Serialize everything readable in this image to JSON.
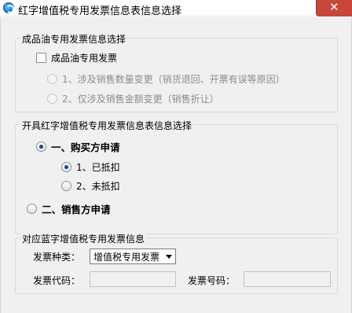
{
  "window": {
    "title": "红字增值税专用发票信息表信息选择",
    "close_label": "✕"
  },
  "oil_group": {
    "legend": "成品油专用发票信息选择",
    "checkbox_label": "成品油专用发票",
    "options": [
      "1、涉及销售数量变更（销货退回、开票有误等原因）",
      "2、仅涉及销售金额变更（销售折让）"
    ]
  },
  "issue_group": {
    "legend": "开具红字增值税专用发票信息表信息选择",
    "buyer_label": "一、购买方申请",
    "buyer_options": [
      "1、已抵扣",
      "2、未抵扣"
    ],
    "seller_label": "二、销售方申请"
  },
  "blue_group": {
    "legend": "对应蓝字增值税专用发票信息",
    "invoice_type_label": "发票种类：",
    "invoice_type_value": "增值税专用发票",
    "invoice_code_label": "发票代码：",
    "invoice_code_value": "",
    "invoice_number_label": "发票号码：",
    "invoice_number_value": ""
  },
  "state": {
    "oil_checked": false,
    "buyer_selected": true,
    "buyer_option_selected": 0
  }
}
